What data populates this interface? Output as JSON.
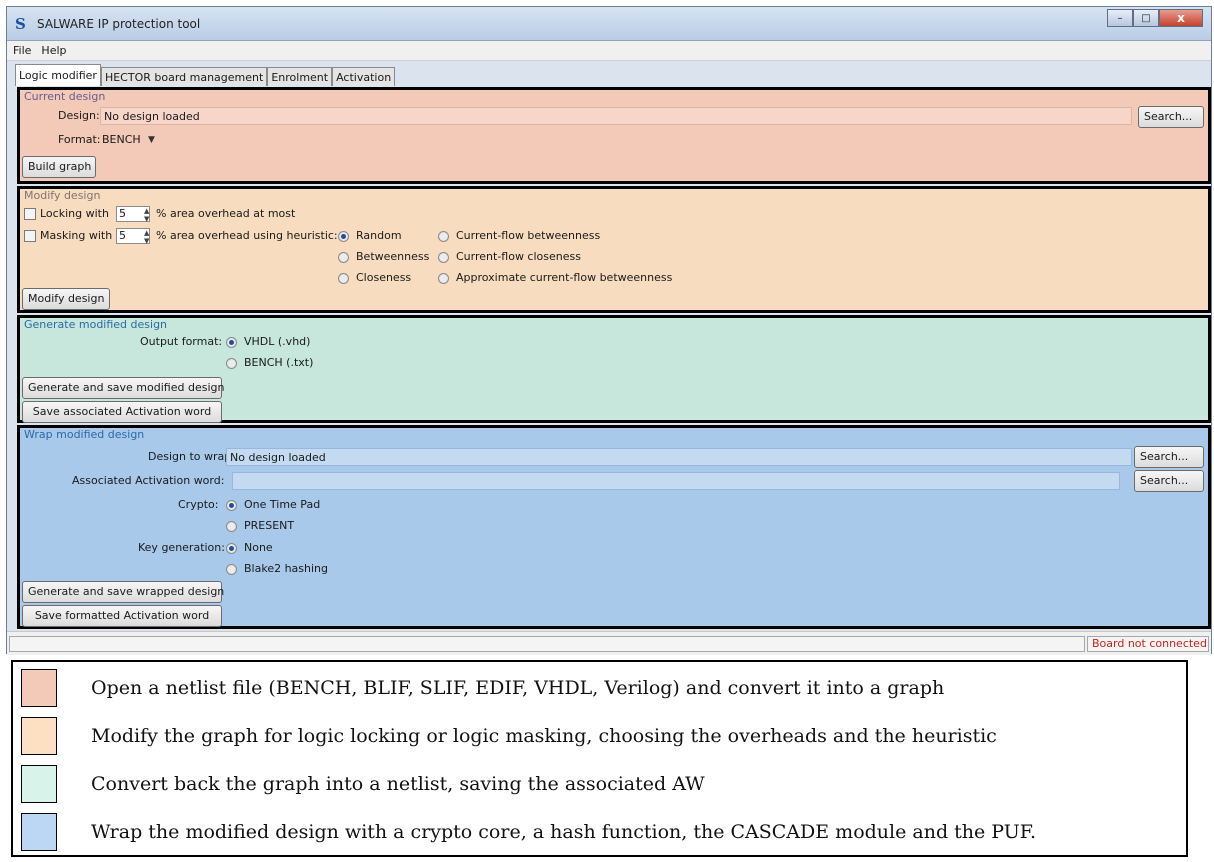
{
  "window": {
    "title": "SALWARE IP protection tool",
    "icon_glyph": "S",
    "minimize": "–",
    "maximize": "□",
    "close": "x"
  },
  "menu": [
    "File",
    "Help"
  ],
  "tabs": [
    "Logic modifier",
    "HECTOR board management",
    "Enrolment",
    "Activation"
  ],
  "current_design": {
    "title": "Current design",
    "design_label": "Design:",
    "design_value": "No design loaded",
    "search": "Search...",
    "format_label": "Format:",
    "format_value": "BENCH",
    "build": "Build graph"
  },
  "modify_design": {
    "title": "Modify design",
    "locking_label": "Locking with",
    "locking_value": "5",
    "locking_suffix": "% area overhead at most",
    "masking_label": "Masking with",
    "masking_value": "5",
    "masking_suffix": "% area overhead using heuristic:",
    "heuristics": {
      "random": "Random",
      "betweenness": "Betweenness",
      "closeness": "Closeness",
      "cf_betweenness": "Current-flow betweenness",
      "cf_closeness": "Current-flow closeness",
      "approx_cf_betweenness": "Approximate current-flow betweenness"
    },
    "button": "Modify design"
  },
  "generate": {
    "title": "Generate modified design",
    "output_label": "Output format:",
    "vhdl": "VHDL (.vhd)",
    "bench": "BENCH (.txt)",
    "generate_btn": "Generate and save modified design",
    "save_aw_btn": "Save associated Activation word"
  },
  "wrap": {
    "title": "Wrap modified design",
    "design_label": "Design to wrap:",
    "design_value": "No design loaded",
    "aw_label": "Associated Activation word:",
    "aw_value": "",
    "search": "Search...",
    "crypto_label": "Crypto:",
    "otp": "One Time Pad",
    "present": "PRESENT",
    "keygen_label": "Key generation:",
    "none": "None",
    "blake2": "Blake2 hashing",
    "generate_btn": "Generate and save wrapped design",
    "save_aw_btn": "Save formatted Activation word"
  },
  "status": {
    "message": "",
    "board": "Board not connected"
  },
  "legend": [
    {
      "color": "#f3c9b8",
      "text": "Open a netlist file (BENCH, BLIF, SLIF, EDIF, VHDL, Verilog) and convert it into a graph"
    },
    {
      "color": "#fde0c2",
      "text": "Modify the graph for logic locking or logic masking, choosing the overheads and the heuristic"
    },
    {
      "color": "#d8f3ea",
      "text": "Convert back the graph into a netlist, saving the associated AW"
    },
    {
      "color": "#bcd7f3",
      "text": "Wrap the modified design with a crypto core, a hash function, the CASCADE module and the PUF."
    }
  ],
  "colors": {
    "current_design_bg": "#f3c9b8",
    "modify_design_bg": "#f7dcc0",
    "generate_bg": "#c8e7dc",
    "wrap_bg": "#a9c9ea",
    "status_error": "#c4251b"
  }
}
